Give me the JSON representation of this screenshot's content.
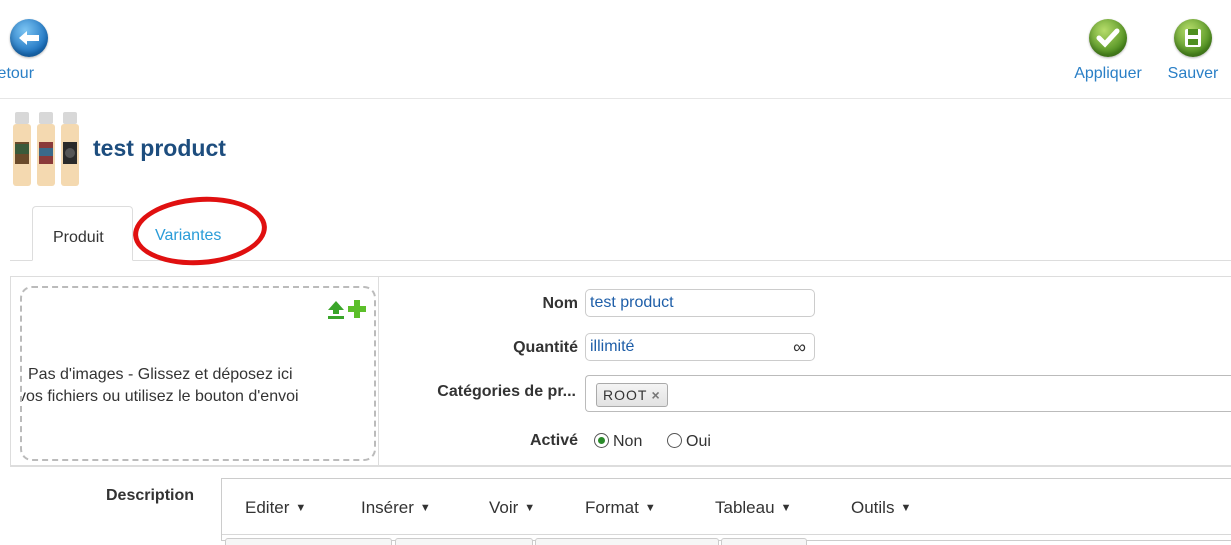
{
  "toolbar": {
    "back_label": "Retour",
    "apply_label": "Appliquer",
    "save_label": "Sauver"
  },
  "product": {
    "title": "test product"
  },
  "tabs": [
    {
      "label": "Produit",
      "active": true
    },
    {
      "label": "Variantes",
      "active": false
    }
  ],
  "images": {
    "empty_line1": "Pas d'images - Glissez et déposez ici",
    "empty_line2": "vos fichiers ou utilisez le bouton d'envoi"
  },
  "form": {
    "name_label": "Nom",
    "name_value": "test product",
    "quantity_label": "Quantité",
    "quantity_value": "illimité",
    "quantity_symbol": "∞",
    "categories_label": "Catégories de pr...",
    "category_tag": "ROOT",
    "tag_remove": "×",
    "active_label": "Activé",
    "active_options": [
      "Non",
      "Oui"
    ],
    "active_selected": "Non"
  },
  "description": {
    "label": "Description",
    "menu": [
      "Editer",
      "Insérer",
      "Voir",
      "Format",
      "Tableau",
      "Outils"
    ]
  },
  "colors": {
    "link": "#2a9cd8",
    "title": "#1d4d7e",
    "highlight_ring": "#e01010"
  }
}
